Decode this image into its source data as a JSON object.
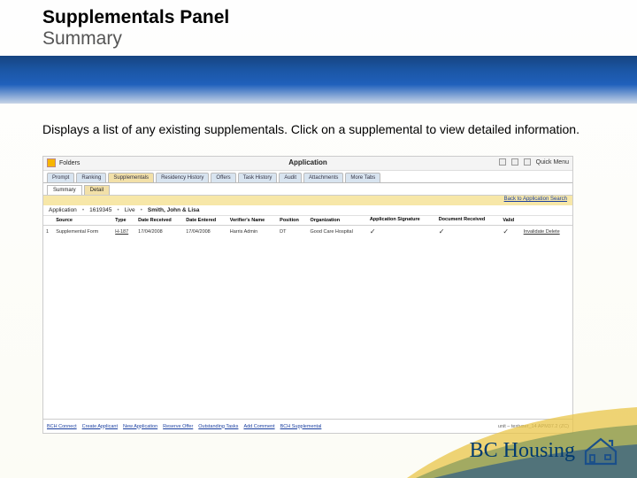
{
  "heading": {
    "title": "Supplementals Panel",
    "subtitle": "Summary"
  },
  "intro": "Displays a list of any existing supplementals. Click on a supplemental to view detailed information.",
  "app": {
    "title": "Application",
    "folder_label": "Folders",
    "quick_menu": "Quick Menu",
    "tabs": [
      "Prompt",
      "Ranking",
      "Supplementals",
      "Residency History",
      "Offers",
      "Task History",
      "Audit",
      "Attachments",
      "More Tabs"
    ],
    "subtabs": [
      "Summary",
      "Detail"
    ],
    "back_link": "Back to Application Search",
    "context": {
      "label": "Application",
      "app_no": "1619345",
      "status": "Live",
      "name": "Smith, John & Lisa"
    },
    "columns": [
      "",
      "Source",
      "Type",
      "Date Received",
      "Date Entered",
      "Verifier's Name",
      "Position",
      "Organization",
      "Application\nSignature",
      "Document\nReceived",
      "Valid",
      ""
    ],
    "row": {
      "idx": "1",
      "source": "Supplemental Form",
      "type": "H-187",
      "date_received": "17/04/2008",
      "date_entered": "17/04/2008",
      "verifier": "Harris Admin",
      "position": "DT",
      "organization": "Good Care Hospital",
      "sig": "✓",
      "doc": "✓",
      "valid": "✓",
      "actions": "Invalidate  Delete"
    },
    "footer_links": [
      "BCH Connect",
      "Create Applicant",
      "New Application",
      "Reserve Offer",
      "Outstanding Tasks",
      "Add Comment",
      "BCH Supplemental"
    ],
    "footer_right": "unit – testuser_14   APM37.2 (ZC)"
  },
  "brand": {
    "name": "BC Housing"
  }
}
